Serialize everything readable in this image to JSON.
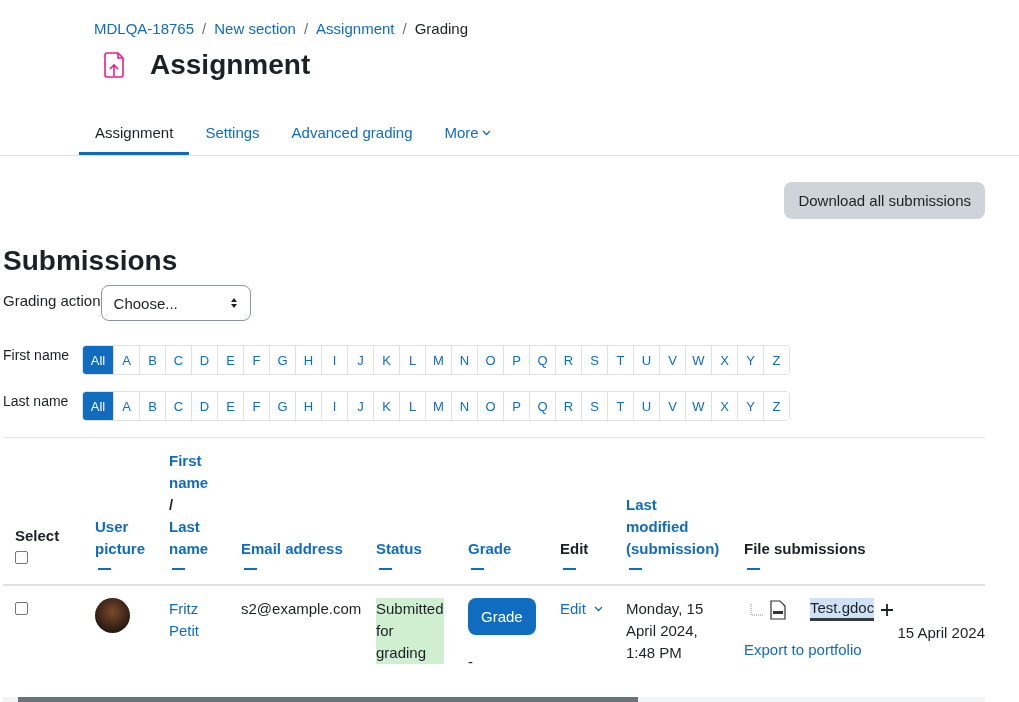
{
  "breadcrumbs": [
    {
      "label": "MDLQA-18765",
      "kind": "link"
    },
    {
      "label": "/",
      "kind": "separator"
    },
    {
      "label": "New section",
      "kind": "link"
    },
    {
      "label": "/",
      "kind": "separator"
    },
    {
      "label": "Assignment",
      "kind": "link"
    },
    {
      "label": "/",
      "kind": "separator"
    },
    {
      "label": "Grading",
      "kind": "current"
    }
  ],
  "page_title": "Assignment",
  "tabs": [
    {
      "label": "Assignment",
      "selected": true,
      "dropdown": false
    },
    {
      "label": "Settings",
      "selected": false,
      "dropdown": false
    },
    {
      "label": "Advanced grading",
      "selected": false,
      "dropdown": false
    },
    {
      "label": "More",
      "selected": false,
      "dropdown": true
    }
  ],
  "download_button": "Download all submissions",
  "section_title": "Submissions",
  "grading_action": {
    "label": "Grading action",
    "value": "Choose..."
  },
  "initials_bars": [
    {
      "label": "First name",
      "letters": [
        {
          "label": "All",
          "selected": true
        },
        {
          "label": "A",
          "selected": false
        },
        {
          "label": "B",
          "selected": false
        },
        {
          "label": "C",
          "selected": false
        },
        {
          "label": "D",
          "selected": false
        },
        {
          "label": "E",
          "selected": false
        },
        {
          "label": "F",
          "selected": false
        },
        {
          "label": "G",
          "selected": false
        },
        {
          "label": "H",
          "selected": false
        },
        {
          "label": "I",
          "selected": false
        },
        {
          "label": "J",
          "selected": false
        },
        {
          "label": "K",
          "selected": false
        },
        {
          "label": "L",
          "selected": false
        },
        {
          "label": "M",
          "selected": false
        },
        {
          "label": "N",
          "selected": false
        },
        {
          "label": "O",
          "selected": false
        },
        {
          "label": "P",
          "selected": false
        },
        {
          "label": "Q",
          "selected": false
        },
        {
          "label": "R",
          "selected": false
        },
        {
          "label": "S",
          "selected": false
        },
        {
          "label": "T",
          "selected": false
        },
        {
          "label": "U",
          "selected": false
        },
        {
          "label": "V",
          "selected": false
        },
        {
          "label": "W",
          "selected": false
        },
        {
          "label": "X",
          "selected": false
        },
        {
          "label": "Y",
          "selected": false
        },
        {
          "label": "Z",
          "selected": false
        }
      ]
    },
    {
      "label": "Last name",
      "letters": [
        {
          "label": "All",
          "selected": true
        },
        {
          "label": "A",
          "selected": false
        },
        {
          "label": "B",
          "selected": false
        },
        {
          "label": "C",
          "selected": false
        },
        {
          "label": "D",
          "selected": false
        },
        {
          "label": "E",
          "selected": false
        },
        {
          "label": "F",
          "selected": false
        },
        {
          "label": "G",
          "selected": false
        },
        {
          "label": "H",
          "selected": false
        },
        {
          "label": "I",
          "selected": false
        },
        {
          "label": "J",
          "selected": false
        },
        {
          "label": "K",
          "selected": false
        },
        {
          "label": "L",
          "selected": false
        },
        {
          "label": "M",
          "selected": false
        },
        {
          "label": "N",
          "selected": false
        },
        {
          "label": "O",
          "selected": false
        },
        {
          "label": "P",
          "selected": false
        },
        {
          "label": "Q",
          "selected": false
        },
        {
          "label": "R",
          "selected": false
        },
        {
          "label": "S",
          "selected": false
        },
        {
          "label": "T",
          "selected": false
        },
        {
          "label": "U",
          "selected": false
        },
        {
          "label": "V",
          "selected": false
        },
        {
          "label": "W",
          "selected": false
        },
        {
          "label": "X",
          "selected": false
        },
        {
          "label": "Y",
          "selected": false
        },
        {
          "label": "Z",
          "selected": false
        }
      ]
    }
  ],
  "table": {
    "select_all": {
      "label": "Select",
      "checked": false
    },
    "columns": [
      {
        "parts": [
          {
            "text": "User picture",
            "kind": "link"
          }
        ]
      },
      {
        "parts": [
          {
            "text": "First name",
            "kind": "link"
          },
          {
            "text": "/",
            "kind": "text"
          },
          {
            "text": "Last name",
            "kind": "link"
          }
        ]
      },
      {
        "parts": [
          {
            "text": "Email address",
            "kind": "link"
          }
        ]
      },
      {
        "parts": [
          {
            "text": "Status",
            "kind": "link"
          }
        ]
      },
      {
        "parts": [
          {
            "text": "Grade",
            "kind": "link"
          }
        ]
      },
      {
        "parts": [
          {
            "text": "Edit",
            "kind": "text"
          }
        ]
      },
      {
        "parts": [
          {
            "text": "Last modified (submission)",
            "kind": "link"
          }
        ]
      },
      {
        "parts": [
          {
            "text": "File submissions",
            "kind": "text"
          }
        ]
      }
    ],
    "rows": [
      {
        "checked": false,
        "name": "Fritz Petit",
        "email": "s2@example.com",
        "status": "Submitted for grading",
        "grade_button": "Grade",
        "grade": "-",
        "edit": "Edit",
        "last_modified": "Monday, 15 April 2024, 1:48 PM",
        "files": [
          {
            "name": "Test.gdoc",
            "selected": true
          }
        ],
        "export_link": "Export to portfolio",
        "column_10": "15 April 2024"
      }
    ]
  }
}
